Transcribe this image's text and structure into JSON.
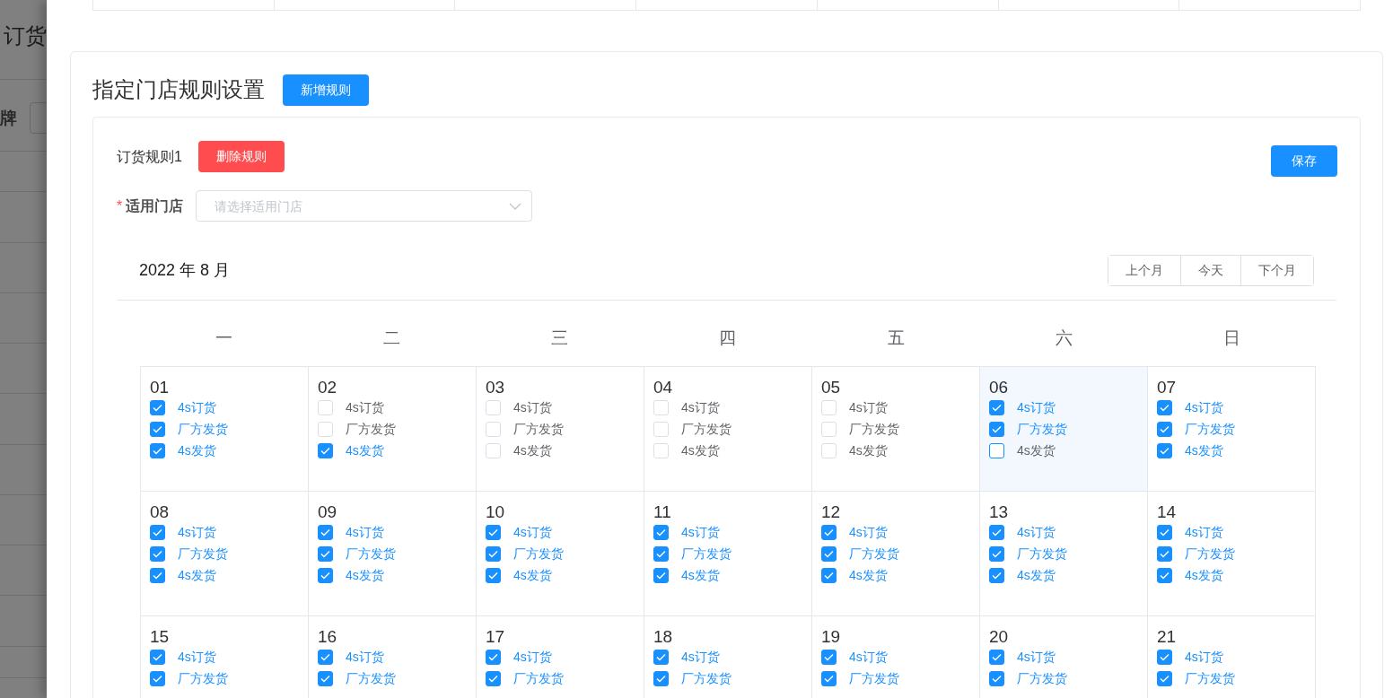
{
  "background_page": {
    "title": "订货",
    "filter_label": "牌"
  },
  "rules_section": {
    "title": "指定门店规则设置",
    "add_button": "新增规则"
  },
  "rule": {
    "name": "订货规则1",
    "delete_button": "删除规则",
    "save_button": "保存",
    "store_field": {
      "required_mark": "*",
      "label": "适用门店",
      "placeholder": "请选择适用门店"
    }
  },
  "calendar": {
    "month_label": "2022 年 8 月",
    "nav_buttons": [
      "上个月",
      "今天",
      "下个月"
    ],
    "weekdays": [
      "一",
      "二",
      "三",
      "四",
      "五",
      "六",
      "日"
    ],
    "days": [
      {
        "day": "01",
        "selected": false,
        "checks": [
          {
            "label": "4s订货",
            "checked": true
          },
          {
            "label": "厂方发货",
            "checked": true
          },
          {
            "label": "4s发货",
            "checked": true
          }
        ]
      },
      {
        "day": "02",
        "selected": false,
        "checks": [
          {
            "label": "4s订货",
            "checked": false
          },
          {
            "label": "厂方发货",
            "checked": false
          },
          {
            "label": "4s发货",
            "checked": true
          }
        ]
      },
      {
        "day": "03",
        "selected": false,
        "checks": [
          {
            "label": "4s订货",
            "checked": false
          },
          {
            "label": "厂方发货",
            "checked": false
          },
          {
            "label": "4s发货",
            "checked": false
          }
        ]
      },
      {
        "day": "04",
        "selected": false,
        "checks": [
          {
            "label": "4s订货",
            "checked": false
          },
          {
            "label": "厂方发货",
            "checked": false
          },
          {
            "label": "4s发货",
            "checked": false
          }
        ]
      },
      {
        "day": "05",
        "selected": false,
        "checks": [
          {
            "label": "4s订货",
            "checked": false
          },
          {
            "label": "厂方发货",
            "checked": false
          },
          {
            "label": "4s发货",
            "checked": false
          }
        ]
      },
      {
        "day": "06",
        "selected": true,
        "checks": [
          {
            "label": "4s订货",
            "checked": true
          },
          {
            "label": "厂方发货",
            "checked": true
          },
          {
            "label": "4s发货",
            "checked": false
          }
        ]
      },
      {
        "day": "07",
        "selected": false,
        "checks": [
          {
            "label": "4s订货",
            "checked": true
          },
          {
            "label": "厂方发货",
            "checked": true
          },
          {
            "label": "4s发货",
            "checked": true
          }
        ]
      },
      {
        "day": "08",
        "selected": false,
        "checks": [
          {
            "label": "4s订货",
            "checked": true
          },
          {
            "label": "厂方发货",
            "checked": true
          },
          {
            "label": "4s发货",
            "checked": true
          }
        ]
      },
      {
        "day": "09",
        "selected": false,
        "checks": [
          {
            "label": "4s订货",
            "checked": true
          },
          {
            "label": "厂方发货",
            "checked": true
          },
          {
            "label": "4s发货",
            "checked": true
          }
        ]
      },
      {
        "day": "10",
        "selected": false,
        "checks": [
          {
            "label": "4s订货",
            "checked": true
          },
          {
            "label": "厂方发货",
            "checked": true
          },
          {
            "label": "4s发货",
            "checked": true
          }
        ]
      },
      {
        "day": "11",
        "selected": false,
        "checks": [
          {
            "label": "4s订货",
            "checked": true
          },
          {
            "label": "厂方发货",
            "checked": true
          },
          {
            "label": "4s发货",
            "checked": true
          }
        ]
      },
      {
        "day": "12",
        "selected": false,
        "checks": [
          {
            "label": "4s订货",
            "checked": true
          },
          {
            "label": "厂方发货",
            "checked": true
          },
          {
            "label": "4s发货",
            "checked": true
          }
        ]
      },
      {
        "day": "13",
        "selected": false,
        "checks": [
          {
            "label": "4s订货",
            "checked": true
          },
          {
            "label": "厂方发货",
            "checked": true
          },
          {
            "label": "4s发货",
            "checked": true
          }
        ]
      },
      {
        "day": "14",
        "selected": false,
        "checks": [
          {
            "label": "4s订货",
            "checked": true
          },
          {
            "label": "厂方发货",
            "checked": true
          },
          {
            "label": "4s发货",
            "checked": true
          }
        ]
      },
      {
        "day": "15",
        "selected": false,
        "checks": [
          {
            "label": "4s订货",
            "checked": true
          },
          {
            "label": "厂方发货",
            "checked": true
          }
        ]
      },
      {
        "day": "16",
        "selected": false,
        "checks": [
          {
            "label": "4s订货",
            "checked": true
          },
          {
            "label": "厂方发货",
            "checked": true
          }
        ]
      },
      {
        "day": "17",
        "selected": false,
        "checks": [
          {
            "label": "4s订货",
            "checked": true
          },
          {
            "label": "厂方发货",
            "checked": true
          }
        ]
      },
      {
        "day": "18",
        "selected": false,
        "checks": [
          {
            "label": "4s订货",
            "checked": true
          },
          {
            "label": "厂方发货",
            "checked": true
          }
        ]
      },
      {
        "day": "19",
        "selected": false,
        "checks": [
          {
            "label": "4s订货",
            "checked": true
          },
          {
            "label": "厂方发货",
            "checked": true
          }
        ]
      },
      {
        "day": "20",
        "selected": false,
        "checks": [
          {
            "label": "4s订货",
            "checked": true
          },
          {
            "label": "厂方发货",
            "checked": true
          }
        ]
      },
      {
        "day": "21",
        "selected": false,
        "checks": [
          {
            "label": "4s订货",
            "checked": true
          },
          {
            "label": "厂方发货",
            "checked": true
          }
        ]
      }
    ]
  }
}
